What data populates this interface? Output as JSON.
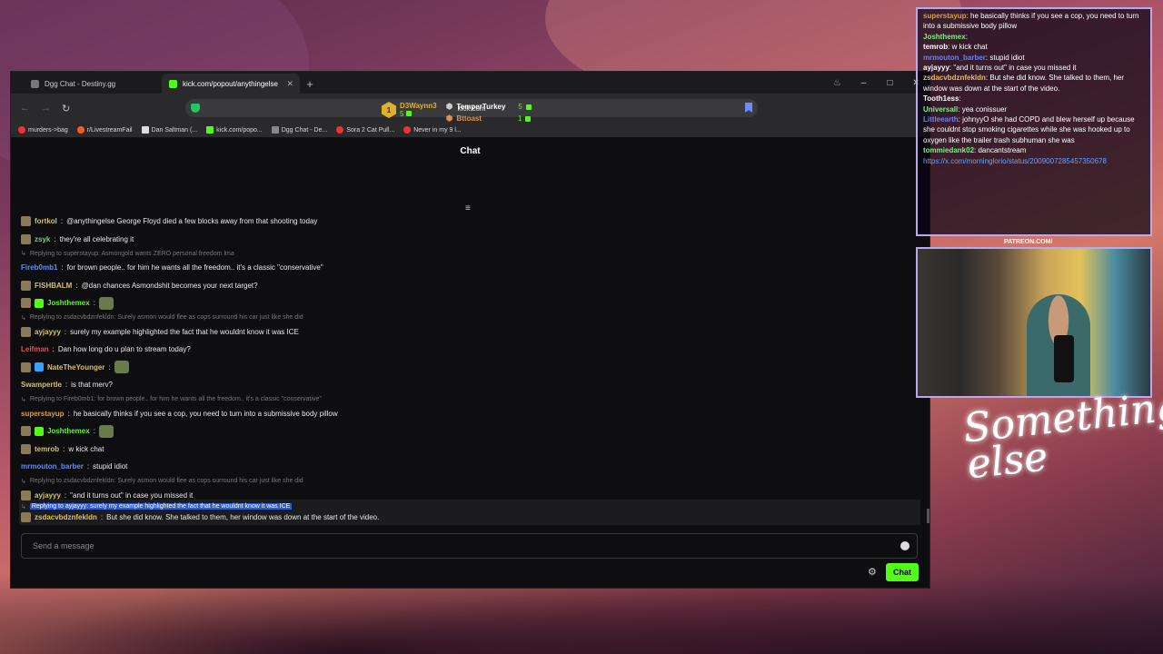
{
  "browser": {
    "tabs": [
      {
        "label": "Dgg Chat - Destiny.gg",
        "active": false
      },
      {
        "label": "kick.com/popout/anythingelse",
        "active": true
      }
    ],
    "new_tab": "+",
    "url": "kick.com",
    "window_controls": [
      "–",
      "□",
      "✕"
    ],
    "bookmarks": [
      "murders->bag",
      "r/LivestreamFail",
      "Dan Saltman (...",
      "kick.com/popo...",
      "Dgg Chat - De...",
      "Sora 2 Cat Pull...",
      "Never in my 9 l..."
    ]
  },
  "chat": {
    "title": "Chat",
    "leaderboard": {
      "first": {
        "rank": "1",
        "name": "D3Waynn3",
        "count": "5"
      },
      "second": {
        "name": "TemperTurkey",
        "count": "5"
      },
      "third": {
        "name": "Bttoast",
        "count": "1"
      }
    },
    "messages": [
      {
        "type": "msg",
        "user": "fortkol",
        "color": "#d4c26a",
        "text": "@anythingelse George Floyd died a few blocks away from that shooting today"
      },
      {
        "type": "msg",
        "user": "zsyk",
        "color": "#6bd66b",
        "text": "they're all celebrating it"
      },
      {
        "type": "reply",
        "text": "Replying to superstayup: Asmongold wants ZERO personal freedom lma"
      },
      {
        "type": "msg",
        "user": "Fireb0mb1",
        "color": "#5b8dff",
        "text": "for brown people.. for him he wants all the freedom.. it's a classic \"conservative\"",
        "noavatar": true
      },
      {
        "type": "msg",
        "user": "FISHBALM",
        "color": "#d4c26a",
        "text": "@dan chances Asmondshit becomes your next target?"
      },
      {
        "type": "msg",
        "user": "Joshthemex",
        "color": "#53fc18",
        "text": "",
        "emote": true,
        "badge": "#53fc18"
      },
      {
        "type": "reply",
        "text": "Replying to zsdacvbdznfekldn: Surely asmon would flee as cops surround his car just like she did"
      },
      {
        "type": "msg",
        "user": "ayjayyy",
        "color": "#d4c26a",
        "text": "surely my example highlighted the fact that he wouldnt know it was ICE"
      },
      {
        "type": "msg",
        "user": "Leifman",
        "color": "#e05050",
        "text": "Dan how long do u plan to stream today?",
        "noavatar": true
      },
      {
        "type": "msg",
        "user": "NateTheYounger",
        "color": "#d4c26a",
        "text": "",
        "emote": true,
        "badge": "#3aa0ff"
      },
      {
        "type": "msg",
        "user": "Swampertle",
        "color": "#d4c26a",
        "text": "is that merv?",
        "noavatar": true
      },
      {
        "type": "reply",
        "text": "Replying to Fireb0mb1: for brown people.. for him he wants all the freedom.. it's a classic \"conservative\""
      },
      {
        "type": "msg",
        "user": "superstayup",
        "color": "#e0a030",
        "text": "he basically thinks if you see a cop, you need to turn into a submissive body pillow",
        "noavatar": true
      },
      {
        "type": "msg",
        "user": "Joshthemex",
        "color": "#53fc18",
        "text": "",
        "emote": true,
        "badge": "#53fc18"
      },
      {
        "type": "msg",
        "user": "temrob",
        "color": "#d4c26a",
        "text": "w kick chat"
      },
      {
        "type": "msg",
        "user": "mrmouton_barber",
        "color": "#5b8dff",
        "text": "stupid idiot",
        "noavatar": true
      },
      {
        "type": "reply",
        "text": "Replying to zsdacvbdznfekldn: Surely asmon would flee as cops surround his car just like she did"
      },
      {
        "type": "msg",
        "user": "ayjayyy",
        "color": "#d4c26a",
        "text": "\"and it turns out\" in case you missed it"
      }
    ],
    "highlighted": {
      "reply": "Replying to ayjayyy: surely my example highlighted the fact that he wouldnt know it was ICE",
      "user": "zsdacvbdznfekldn",
      "text": "But she did know. She talked to them, her window was down at the start of the video."
    },
    "input_placeholder": "Send a message",
    "send_label": "Chat"
  },
  "overlay": {
    "messages": [
      {
        "user": "superstayup",
        "color": "#e0a030",
        "text": "he basically thinks if you see a cop, you need to turn into a submissive body pillow"
      },
      {
        "user": "Joshthemex",
        "color": "#7ef07e",
        "text": ""
      },
      {
        "user": "temrob",
        "color": "#ffffff",
        "text": "w kick chat"
      },
      {
        "user": "mrmouton_barber",
        "color": "#6a80ff",
        "text": "stupid idiot"
      },
      {
        "user": "ayjayyy",
        "color": "#ffffff",
        "text": "\"and it turns out\" in case you missed it"
      },
      {
        "user": "zsdacvbdznfekldn",
        "color": "#e0c060",
        "text": "But she did know. She talked to them, her window was down at the start of the video."
      },
      {
        "user": "Tooth1ess",
        "color": "#ffffff",
        "text": ""
      },
      {
        "user": "Universall",
        "color": "#7ef07e",
        "text": "yea conissuer"
      },
      {
        "user": "Littleearth",
        "color": "#6a80ff",
        "text": "johnyyO she had COPD and blew herself up because she couldnt stop smoking cigarettes while she was hooked up to oxygen like the trailer trash subhuman she was"
      },
      {
        "user": "tommiedank02",
        "color": "#7ef07e",
        "text": "dancantstream"
      },
      {
        "user": "",
        "color": "#6aa0ff",
        "text": "https://x.com/morninglorio/status/2009007285457350678"
      }
    ],
    "patreon": "PATREON.COM/",
    "signature": "Something else"
  }
}
